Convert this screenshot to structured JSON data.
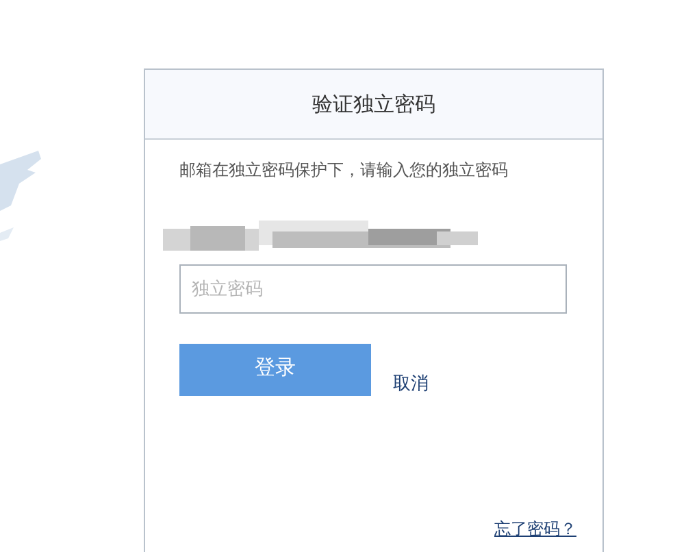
{
  "dialog": {
    "title": "验证独立密码",
    "message": "邮箱在独立密码保护下，请输入您的独立密码",
    "account_redacted": true,
    "password_field": {
      "placeholder": "独立密码"
    },
    "login_button": "登录",
    "cancel_link": "取消",
    "forgot_link": "忘了密码？"
  }
}
